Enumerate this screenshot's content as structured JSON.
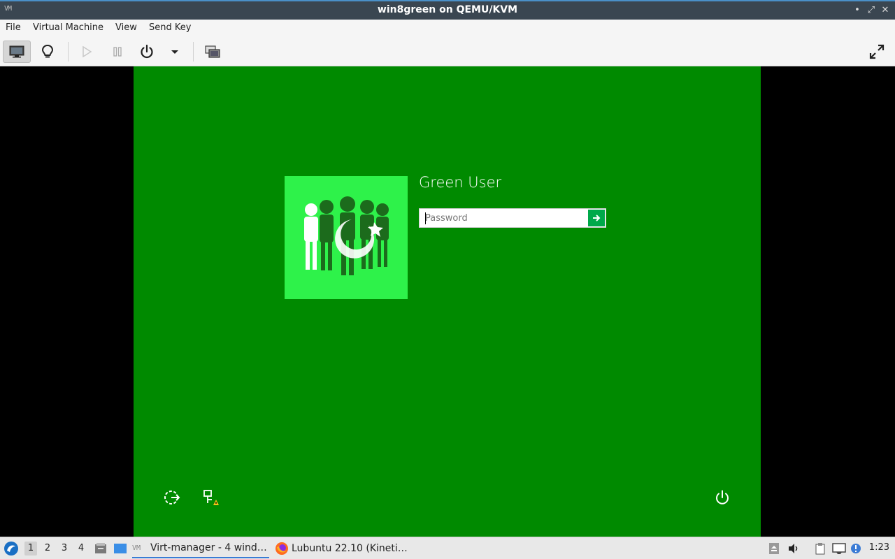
{
  "window": {
    "title": "win8green on QEMU/KVM",
    "app_icon_text": "VM",
    "minimize": "•",
    "maximize": "⤢",
    "close": "✕"
  },
  "menu": {
    "items": [
      "File",
      "Virtual Machine",
      "View",
      "Send Key"
    ]
  },
  "toolbar": {
    "icons": [
      "monitor-icon",
      "lightbulb-icon",
      "play-icon",
      "pause-icon",
      "power-icon",
      "dropdown-arrow-icon",
      "snapshots-icon",
      "fullscreen-icon"
    ]
  },
  "login": {
    "user_name": "Green User",
    "password_placeholder": "Password",
    "password_value": "",
    "submit_icon": "arrow-right-icon",
    "ease_of_access_icon": "ease-of-access-icon",
    "network_icon": "network-warning-icon",
    "power_icon": "power-icon"
  },
  "taskbar": {
    "start_icon": "lubuntu-icon",
    "workspaces": [
      "1",
      "2",
      "3",
      "4"
    ],
    "current_workspace": "1",
    "tasks": [
      {
        "label": "Virt-manager - 4 wind…",
        "icon": "virt-manager-icon",
        "active": true
      },
      {
        "label": "Lubuntu 22.10 (Kineti…",
        "icon": "firefox-icon",
        "active": false
      }
    ],
    "tray_icons": [
      "eject-icon",
      "volume-icon",
      "clipboard-icon",
      "display-icon",
      "update-notifier-icon"
    ],
    "clock": "1:23"
  },
  "colors": {
    "vm_background": "#008a00",
    "avatar_tile": "#2ef24a",
    "submit_button": "#00a94a",
    "titlebar": "#3a4651"
  }
}
